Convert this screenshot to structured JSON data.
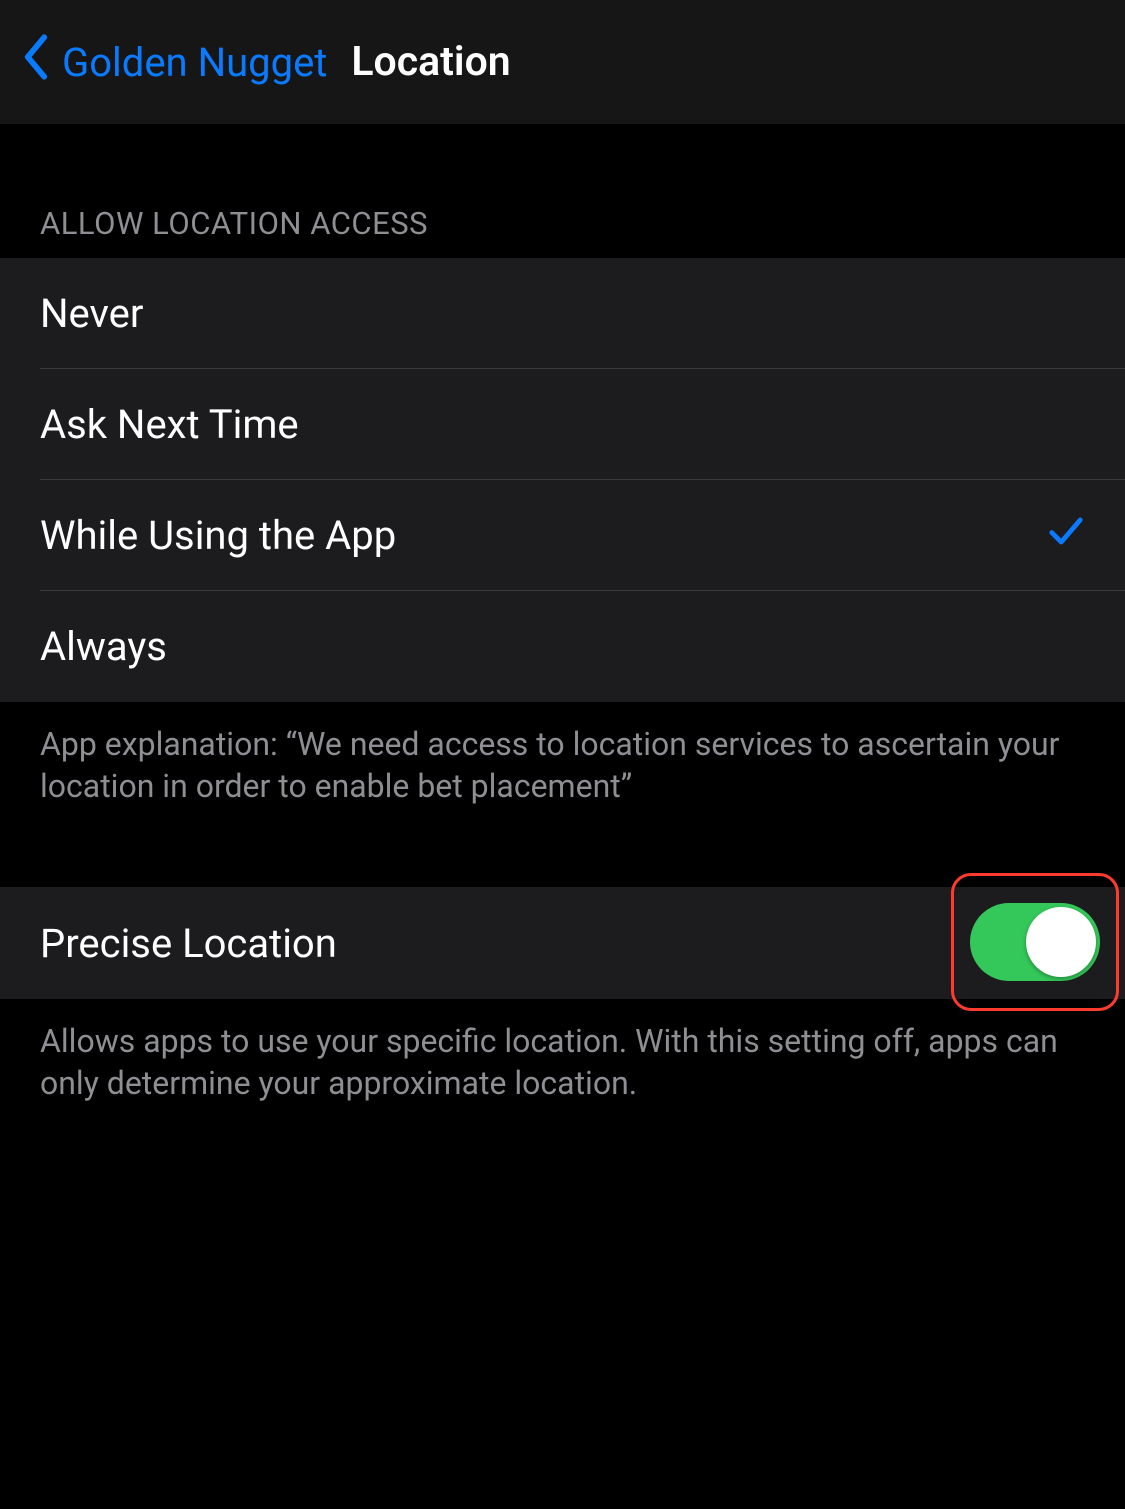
{
  "header": {
    "back_label": "Golden Nugget",
    "title": "Location"
  },
  "section": {
    "title": "ALLOW LOCATION ACCESS",
    "options": [
      {
        "label": "Never",
        "selected": false
      },
      {
        "label": "Ask Next Time",
        "selected": false
      },
      {
        "label": "While Using the App",
        "selected": true
      },
      {
        "label": "Always",
        "selected": false
      }
    ],
    "footer": "App explanation: “We need access to location services to ascertain your location in order to enable bet placement”"
  },
  "precise": {
    "label": "Precise Location",
    "enabled": true,
    "footer": "Allows apps to use your specific location. With this setting off, apps can only determine your approximate location."
  },
  "colors": {
    "accent_blue": "#0a7aff",
    "toggle_green": "#34c759",
    "highlight_red": "#ff3b30"
  }
}
